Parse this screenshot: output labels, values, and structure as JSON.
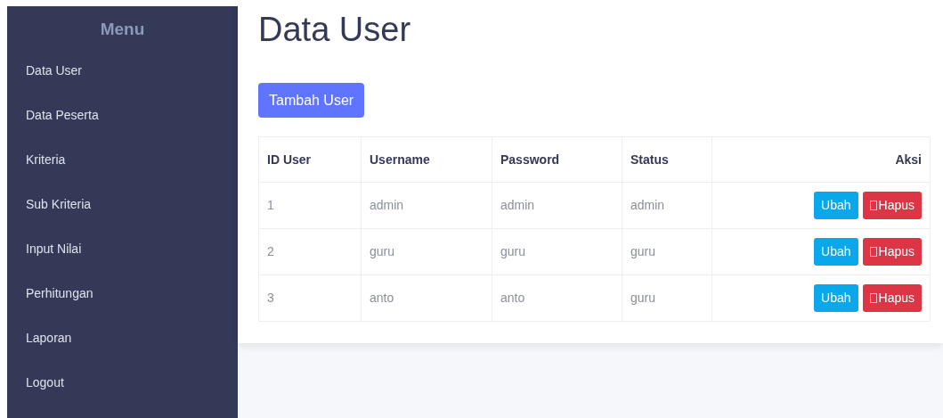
{
  "sidebar": {
    "title": "Menu",
    "items": [
      "Data User",
      "Data Peserta",
      "Kriteria",
      "Sub Kriteria",
      "Input Nilai",
      "Perhitungan",
      "Laporan",
      "Logout"
    ]
  },
  "page_title": "Data User",
  "add_button": "Tambah User",
  "table": {
    "columns": [
      "ID User",
      "Username",
      "Password",
      "Status",
      "Aksi"
    ],
    "rows": [
      {
        "cells": [
          "1",
          "admin",
          "admin",
          "admin"
        ],
        "actions": [
          "Ubah",
          "Hapus"
        ]
      },
      {
        "cells": [
          "2",
          "guru",
          "guru",
          "guru"
        ],
        "actions": [
          "Ubah",
          "Hapus"
        ]
      },
      {
        "cells": [
          "3",
          "anto",
          "anto",
          "guru"
        ],
        "actions": [
          "Ubah",
          "Hapus"
        ]
      }
    ]
  }
}
